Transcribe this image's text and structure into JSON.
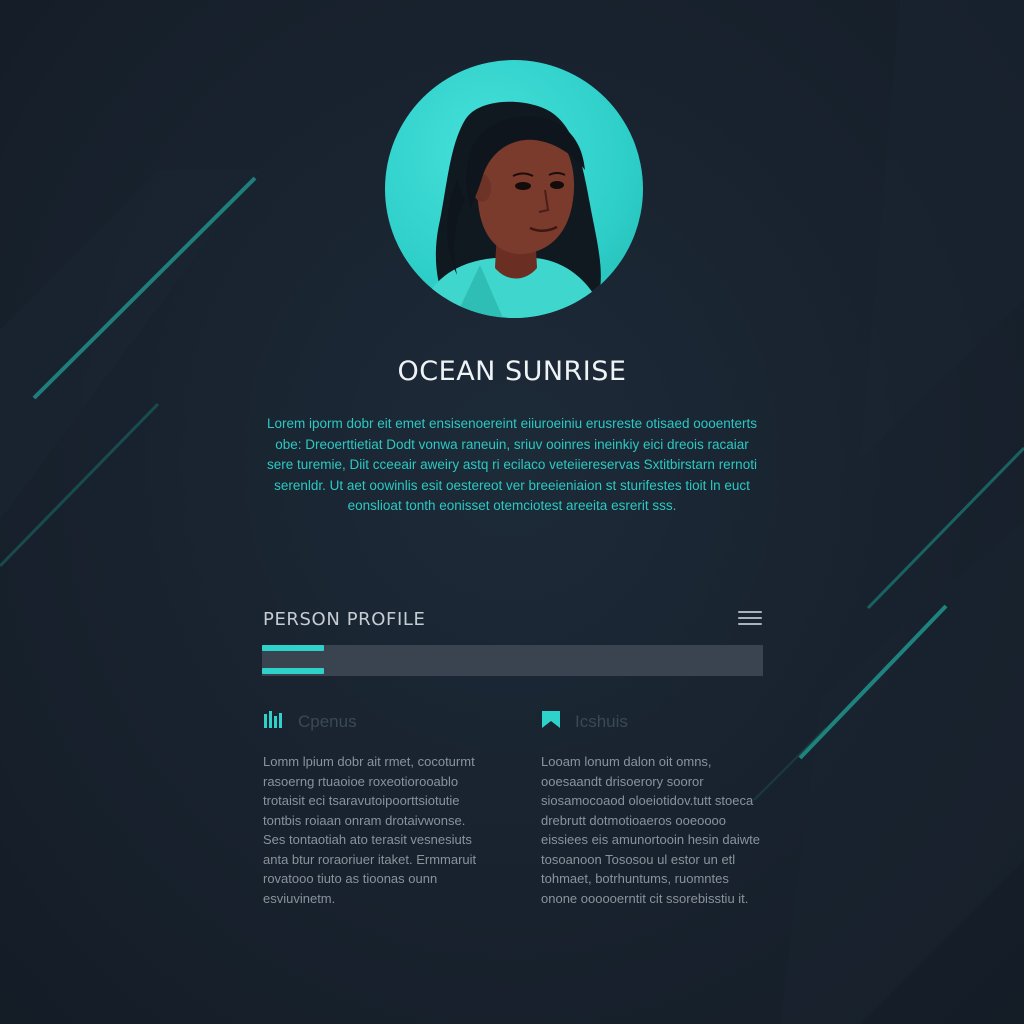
{
  "profile": {
    "name": "OCEAN SUNRISE",
    "bio": "Lorem iporm dobr eit emet ensisenoereint eiiuroeiniu erusreste otisaed oooenterts obe: Dreoerttietiat Dodt vonwa raneuin, sriuv ooinres ineinkiy eici dreois racaiar sere turemie, Diit cceeair aweiry astq ri ecilaco veteiiereservas Sxtitbirstarn rernoti serenldr. Ut aet oowinlis esit oestereot ver breeieniaion st sturifestes tioit ln euct eonslioat tonth eonisset otemciotest areeita esrerit sss.",
    "accent_color": "#2fd2ca",
    "avatar_icon": "person-portrait-icon"
  },
  "section": {
    "title": "PERSON PROFILE",
    "menu_icon": "hamburger-menu-icon"
  },
  "columns": [
    {
      "icon": "bar-chart-icon",
      "label": "Cpenus",
      "text": "Lomm lpium dobr ait rmet, cocoturmt rasoerng rtuaoioe roxeotiorooablo trotaisit eci tsaravutoipoorttsiotutie tontbis roiaan onram drotaivwonse. Ses tontaotiah ato terasit vesnesiuts anta btur roraoriuer itaket. Ermmaruit rovatooo tiuto as tioonas ounn esviuvinetm."
    },
    {
      "icon": "bookmark-icon",
      "label": "Icshuis",
      "text": "Looam lonum dalon oit omns, ooesaandt drisoerory sooror siosamocoaod oloeiotidov.tutt stoeca drebrutt dotmotioaeros ooeoooo eissiees eis amunortooin hesin daiwte tosoanoon Tososou ul estor un etl tohmaet, botrhuntums, ruomntes onone oooooerntit cit ssorebisstiu it."
    }
  ]
}
